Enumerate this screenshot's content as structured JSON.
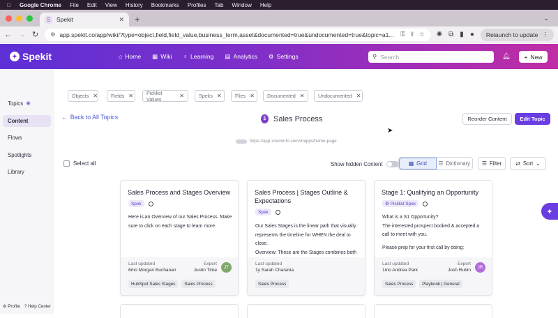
{
  "mac_menu": [
    "Google Chrome",
    "File",
    "Edit",
    "View",
    "History",
    "Bookmarks",
    "Profiles",
    "Tab",
    "Window",
    "Help"
  ],
  "browser": {
    "tab_title": "Spekit",
    "url": "app.spekit.co/app/wiki/?type=object,field,field_value,business_term,asset&documented=true&undocumented=true&topic=a1...",
    "relaunch_label": "Relaunch to update"
  },
  "header": {
    "logo": "Spekit",
    "nav": [
      {
        "icon": "home-icon",
        "label": "Home"
      },
      {
        "icon": "grid-icon",
        "label": "Wiki"
      },
      {
        "icon": "bulb-icon",
        "label": "Learning"
      },
      {
        "icon": "chart-icon",
        "label": "Analytics"
      },
      {
        "icon": "gear-icon",
        "label": "Settings"
      }
    ],
    "search_placeholder": "Search",
    "new_label": "New"
  },
  "sidebar": {
    "items": [
      "Topics",
      "Content",
      "Flows",
      "Spotlights",
      "Library"
    ],
    "active": "Content",
    "profile": "Profile",
    "help": "Help Center"
  },
  "filters": [
    "Objects",
    "Fields",
    "Picklist Values",
    "Speks",
    "Files",
    "Documented",
    "Undocumented"
  ],
  "topic": {
    "back_label": "Back to All Topics",
    "title": "Sales Process",
    "reorder_label": "Reorder Content",
    "edit_label": "Edit Topic",
    "url_badge": "https://app.zoominfo.com/#/apps/home-page"
  },
  "toolbar": {
    "select_all": "Select all",
    "show_hidden": "Show hidden Content",
    "grid": "Grid",
    "dictionary": "Dictionary",
    "filter": "Filter",
    "sort": "Sort"
  },
  "cards": [
    {
      "title": "Sales Process and Stages Overview",
      "tag": "Spek",
      "body": [
        "Here is an Overview of our Sales Process. Make sure to click on each stage to learn more."
      ],
      "last_updated_label": "Last updated",
      "last_updated": "6mo Morgan Buchanan",
      "expert_label": "Expert",
      "expert": "Justin Time",
      "initials": "JT",
      "avatar_color": "#7fa86b",
      "topics": [
        "HubSpot Sales Stages",
        "Sales Process"
      ]
    },
    {
      "title": "Sales Process | Stages Outline & Expectations",
      "tag": "Spek",
      "body": [
        "Our Sales Stages  is the linear path that visually represents the timeline for WHEN the deal to close.",
        "Overview: These are the Stages combines both"
      ],
      "last_updated_label": "Last updated",
      "last_updated": "1y Sarah Charania",
      "expert_label": "",
      "expert": "",
      "initials": "",
      "avatar_color": "",
      "topics": [
        "Sales Process"
      ]
    },
    {
      "title": "Stage 1: Qualifying an Opportunity",
      "tag": "Picklist Spek",
      "body": [
        "What is a S1 Opportunity?",
        "The interested prospect booked & accepted a call to meet with you.",
        "",
        "Please prep for your first call by doing:"
      ],
      "last_updated_label": "Last updated",
      "last_updated": "1mo Andrea Park",
      "expert_label": "Expert",
      "expert": "Josh Rubin",
      "initials": "JR",
      "avatar_color": "#b46ad9",
      "topics": [
        "Sales Process",
        "Playbook | General"
      ]
    }
  ]
}
